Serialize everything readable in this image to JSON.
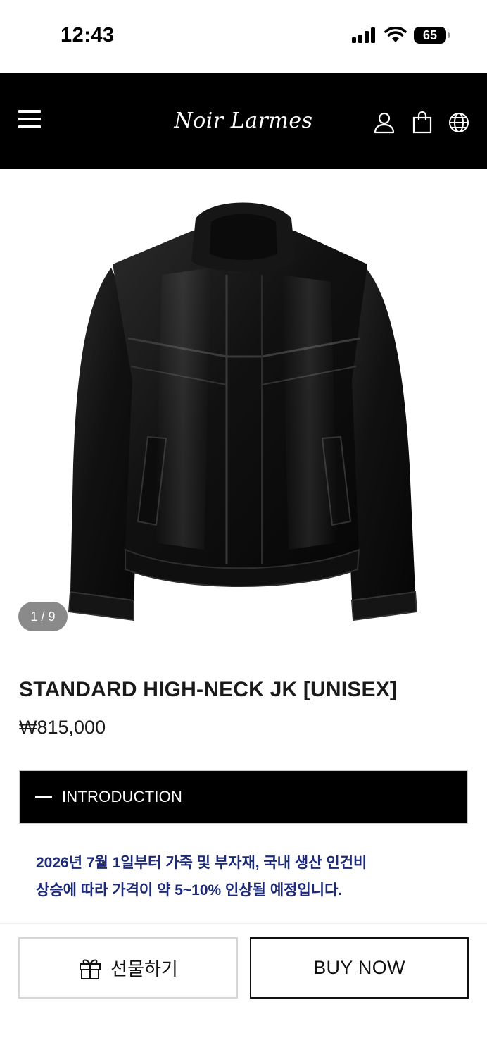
{
  "status_bar": {
    "time": "12:43",
    "battery": "65"
  },
  "header": {
    "logo": "Noir Larmes"
  },
  "gallery": {
    "counter": "1 / 9"
  },
  "product": {
    "title": "STANDARD HIGH-NECK JK [UNISEX]",
    "price": "₩815,000"
  },
  "intro": {
    "label": "INTRODUCTION"
  },
  "notice": {
    "line1": "2026년 7월 1일부터 가죽 및 부자재, 국내 생산 인건비",
    "line2": "상승에 따라 가격이 약 5~10% 인상될 예정입니다."
  },
  "actions": {
    "gift_label": "선물하기",
    "buy_label": "BUY NOW"
  },
  "colors": {
    "header_bg": "#000000",
    "notice_text": "#1c2a78",
    "counter_bg": "#8a8a8a"
  }
}
